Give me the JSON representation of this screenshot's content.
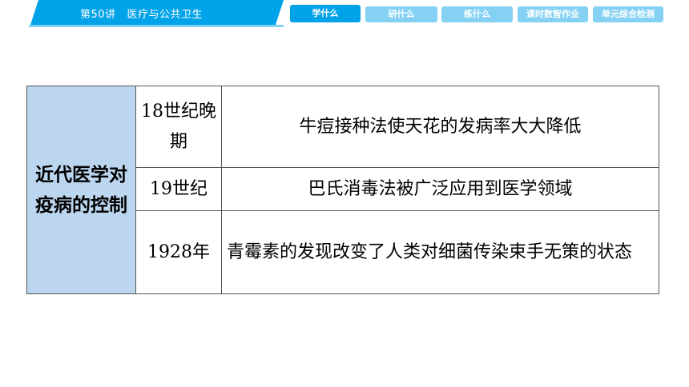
{
  "header": {
    "lesson_number": "第50讲",
    "lesson_topic": "医疗与公共卫生",
    "tabs": [
      {
        "label": "学什么",
        "active": true
      },
      {
        "label": "研什么",
        "active": false
      },
      {
        "label": "练什么",
        "active": false
      },
      {
        "label": "课时数智作业",
        "active": false
      },
      {
        "label": "单元综合检测",
        "active": false
      }
    ]
  },
  "table": {
    "category": "近代医学对疫病的控制",
    "rows": [
      {
        "time": "18世纪晚期",
        "event": "牛痘接种法使天花的发病率大大降低"
      },
      {
        "time": "19世纪",
        "event": "巴氏消毒法被广泛应用到医学领域"
      },
      {
        "time": "1928年",
        "event": "青霉素的发现改变了人类对细菌传染束手无策的状态"
      }
    ]
  },
  "colors": {
    "accent": "#00a2e8",
    "tab_inactive": "#85d1f3",
    "category_bg": "#bcd6ef"
  }
}
